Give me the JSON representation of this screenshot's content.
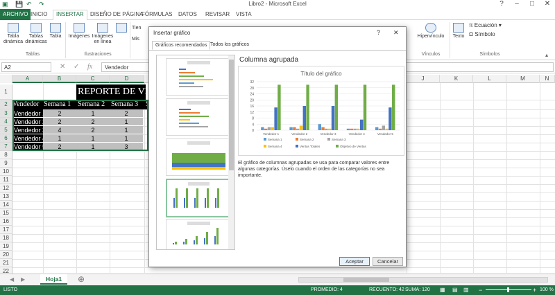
{
  "window": {
    "title": "Libro2 - Microsoft Excel"
  },
  "ribbon_tabs": [
    "ARCHIVO",
    "INICIO",
    "INSERTAR",
    "DISEÑO DE PÁGINA",
    "FÓRMULAS",
    "DATOS",
    "REVISAR",
    "VISTA"
  ],
  "ribbon": {
    "tabla_dinamica": "Tabla dinámica",
    "tablas_dinamicas": "Tablas dinámicas",
    "tabla": "Tabla",
    "imagenes": "Imágenes",
    "imagenes_linea": "Imágenes en línea",
    "tienda": "Tien",
    "mis": "Mis",
    "hipervinculo": "Hipervínculo",
    "texto": "Texto",
    "ecuacion": "Ecuación",
    "simbolo": "Símbolo",
    "groups": {
      "tablas": "Tablas",
      "ilustraciones": "Ilustraciones",
      "vinculos": "Vínculos",
      "simbolos": "Símbolos"
    }
  },
  "formula_bar": {
    "name_box": "A2",
    "fx": "fx",
    "value": "Vendedor"
  },
  "columns": [
    "A",
    "B",
    "C",
    "D",
    "",
    "",
    "",
    "",
    "J",
    "K",
    "L",
    "M",
    "N",
    "O"
  ],
  "rows": [
    "1",
    "2",
    "3",
    "4",
    "5",
    "6",
    "7",
    "8",
    "9",
    "10",
    "11",
    "12",
    "13",
    "14",
    "15",
    "16",
    "17",
    "18",
    "19",
    "20",
    "21",
    "22"
  ],
  "table": {
    "title": "REPORTE DE VE",
    "headers": [
      "Vendedor",
      "Semana 1",
      "Semana 2",
      "Semana 3",
      "S"
    ],
    "data": [
      [
        "Vendedor 1",
        "2",
        "1",
        "2"
      ],
      [
        "Vendedor 2",
        "2",
        "2",
        "1"
      ],
      [
        "Vendedor 3",
        "4",
        "2",
        "1"
      ],
      [
        "Vendedor 4",
        "1",
        "1",
        "1"
      ],
      [
        "Vendedor 5",
        "2",
        "1",
        "3"
      ]
    ]
  },
  "sheet_tab": "Hoja1",
  "status": {
    "ready": "LISTO",
    "promedio": "PROMEDIO: 4",
    "recuento": "RECUENTO: 42",
    "suma": "SUMA: 120",
    "zoom": "100 %"
  },
  "dialog": {
    "title": "Insertar gráfico",
    "help": "?",
    "close": "✕",
    "tabs": [
      "Gráficos recomendados",
      "Todos los gráficos"
    ],
    "chart_name": "Columna agrupada",
    "description": "El gráfico de columnas agrupadas se usa para comparar valores entre algunas categorías. Úselo cuando el orden de las categorías no sea importante.",
    "accept": "Aceptar",
    "cancel": "Cancelar"
  },
  "chart_data": {
    "type": "bar",
    "title": "Título del gráfico",
    "categories": [
      "Vendedor 1",
      "Vendedor 2",
      "Vendedor 3",
      "Vendedor 4",
      "Vendedor 5"
    ],
    "ylim": [
      0,
      32
    ],
    "yticks": [
      0,
      4,
      8,
      12,
      16,
      20,
      24,
      28,
      32
    ],
    "grid": true,
    "legend_position": "bottom",
    "series": [
      {
        "name": "Semana 1",
        "color": "#5b9bd5",
        "values": [
          2,
          2,
          4,
          1,
          2
        ]
      },
      {
        "name": "Semana 2",
        "color": "#ed7d31",
        "values": [
          1,
          2,
          2,
          1,
          1
        ]
      },
      {
        "name": "Semana 3",
        "color": "#a5a5a5",
        "values": [
          2,
          1,
          1,
          1,
          3
        ]
      },
      {
        "name": "Semana 4",
        "color": "#ffc000",
        "values": [
          2,
          3,
          1,
          1,
          1
        ]
      },
      {
        "name": "Ventas Totales",
        "color": "#4472c4",
        "values": [
          15,
          16,
          16,
          7,
          15
        ]
      },
      {
        "name": "Objetivo de Ventas",
        "color": "#70ad47",
        "values": [
          30,
          30,
          30,
          30,
          30
        ]
      }
    ]
  }
}
